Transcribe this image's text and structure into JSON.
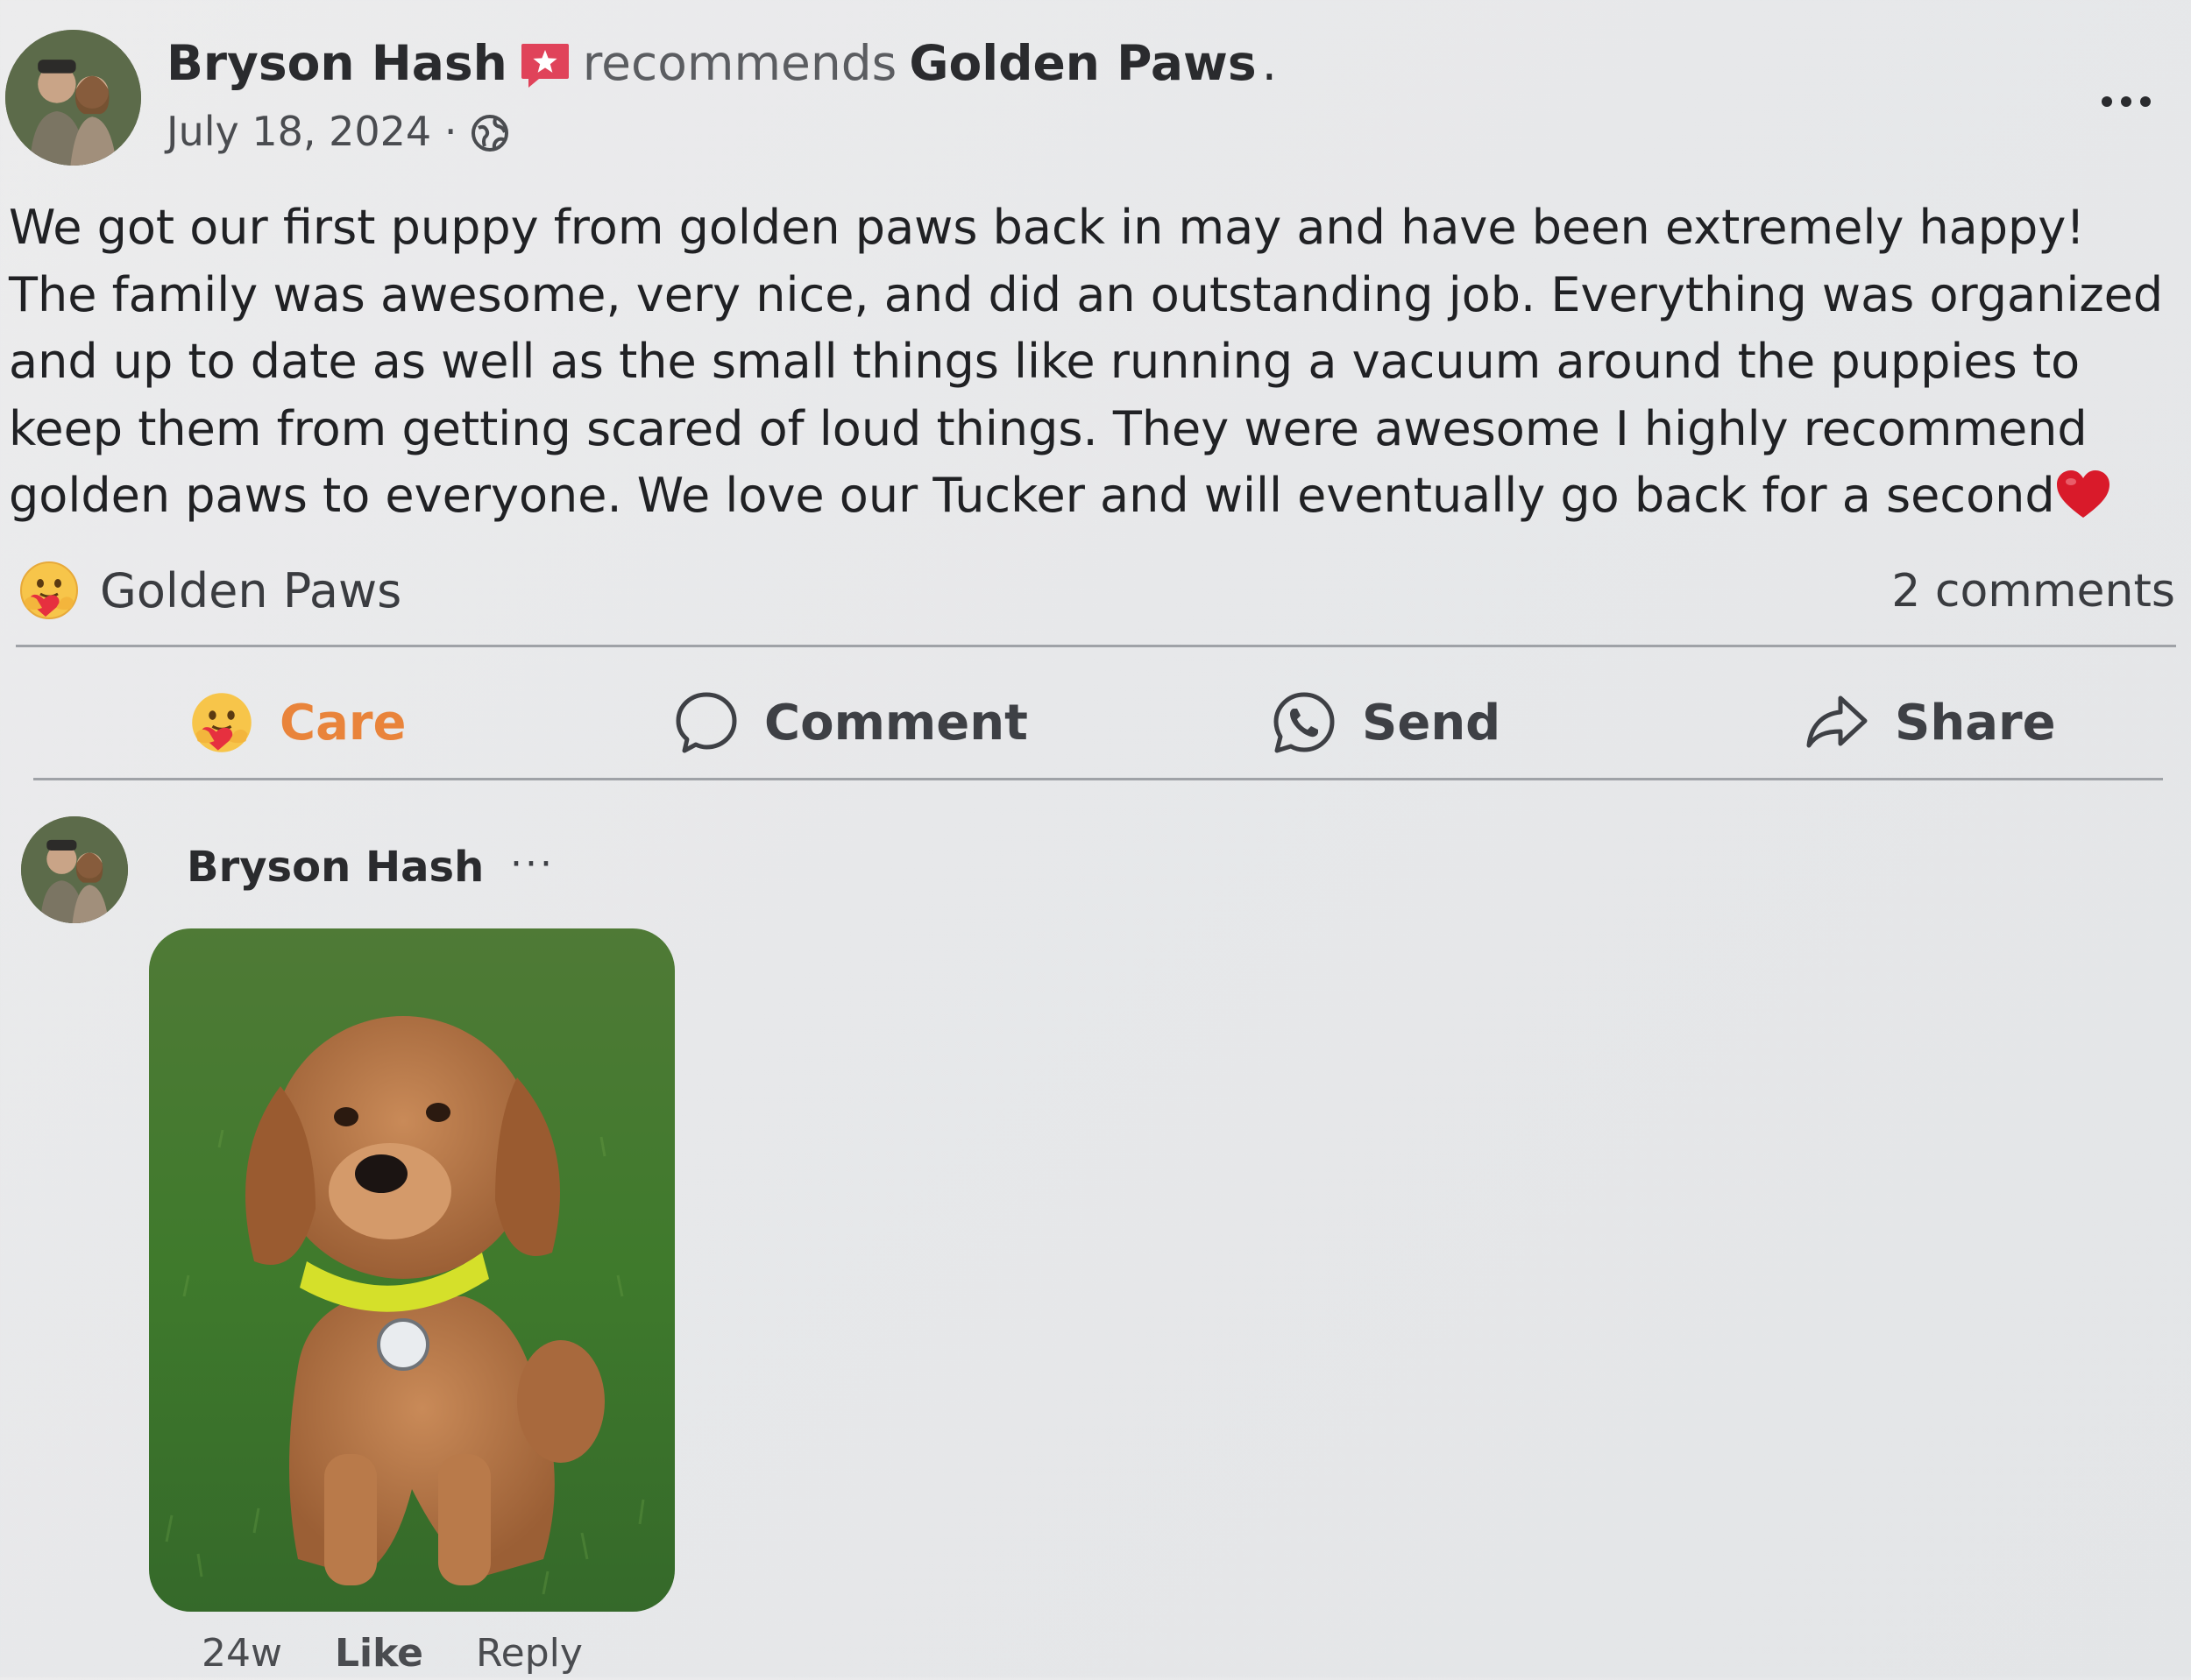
{
  "post": {
    "author": "Bryson Hash",
    "recommends_text": "recommends",
    "page_name": "Golden Paws",
    "page_name_suffix": ".",
    "date": "July 18, 2024",
    "date_separator": " · ",
    "text": "We got our first puppy from golden paws back in may and have been extremely happy! The family was awesome, very nice, and did an outstanding job. Everything was organized and up to date as well as the small things like running a vacuum around the puppies to keep them from getting scared of loud things. They were awesome I highly recommend golden paws to everyone. We love our Tucker and will eventually go back for a second",
    "icons": {
      "more": "more-horizontal-icon",
      "privacy": "globe-icon",
      "recommend_badge": "recommend-badge-icon",
      "heart": "red-heart-emoji"
    }
  },
  "reactions": {
    "summary_name": "Golden Paws",
    "reaction_type": "care-emoji",
    "comments_count": "2 comments"
  },
  "actions": {
    "care": "Care",
    "comment": "Comment",
    "send": "Send",
    "share": "Share"
  },
  "comment": {
    "author": "Bryson Hash",
    "more": "···",
    "time": "24w",
    "like": "Like",
    "reply": "Reply"
  },
  "colors": {
    "care_accent": "#e9843b",
    "heart": "#d91a2a",
    "badge": "#e0435a"
  }
}
